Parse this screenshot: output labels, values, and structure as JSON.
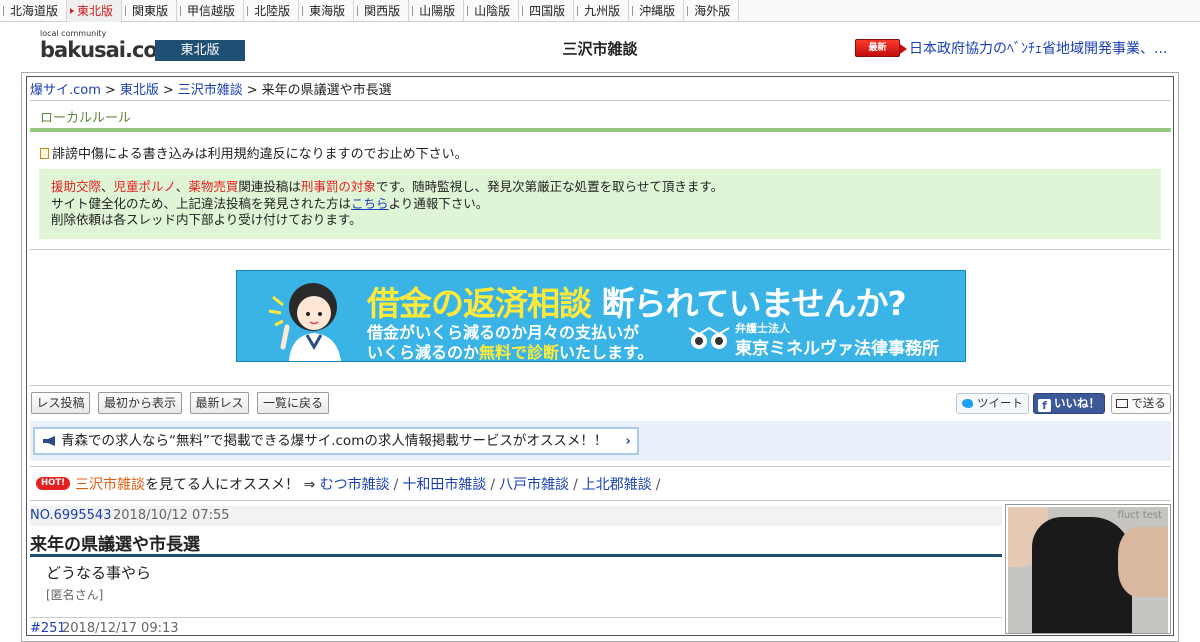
{
  "regions": [
    {
      "label": "北海道版",
      "active": false
    },
    {
      "label": "東北版",
      "active": true
    },
    {
      "label": "関東版",
      "active": false
    },
    {
      "label": "甲信越版",
      "active": false
    },
    {
      "label": "北陸版",
      "active": false
    },
    {
      "label": "東海版",
      "active": false
    },
    {
      "label": "関西版",
      "active": false
    },
    {
      "label": "山陽版",
      "active": false
    },
    {
      "label": "山陰版",
      "active": false
    },
    {
      "label": "四国版",
      "active": false
    },
    {
      "label": "九州版",
      "active": false
    },
    {
      "label": "沖縄版",
      "active": false
    },
    {
      "label": "海外版",
      "active": false
    }
  ],
  "header": {
    "logo_small": "local community",
    "logo": "bakusai.com",
    "region_badge": "東北版",
    "board_title": "三沢市雑談",
    "news_badge": "最新NEWS",
    "news_text": "日本政府協力のﾍﾞﾝﾁｪ省地域開発事業、..."
  },
  "breadcrumb": {
    "items": [
      "爆サイ.com",
      "東北版",
      "三沢市雑談"
    ],
    "current": "来年の県議選や市長選",
    "separator": ">"
  },
  "rules": {
    "title": "ローカルルール",
    "notice": "誹謗中傷による書き込みは利用規約違反になりますのでお止め下さい。",
    "warn_red1": "援助交際",
    "warn_red2": "児童ポルノ",
    "warn_red3": "薬物売買",
    "warn_mid": "関連投稿は",
    "warn_red4": "刑事罰の対象",
    "warn_end": "です。随時監視し、発見次第厳正な処置を取らせて頂きます。",
    "line2_pre": "サイト健全化のため、上記違法投稿を発見された方は",
    "line2_link": "こちら",
    "line2_post": "より通報下さい。",
    "line3": "削除依頼は各スレッド内下部より受け付けております。",
    "comma": "、"
  },
  "banner": {
    "headline_a": "借金の返済相談",
    "headline_b": "断られていませんか?",
    "sub1": "借金がいくら減るのか月々の支払いが",
    "sub2_a": "いくら減るのか",
    "sub2_b": "無料で診断",
    "sub2_c": "いたします。",
    "firm_small": "弁護士法人",
    "firm": "東京ミネルヴァ法律事務所"
  },
  "toolbar": {
    "post_reply": "レス投稿",
    "from_start": "最初から表示",
    "latest": "最新レス",
    "back_to_list": "一覧に戻る",
    "tweet": "ツイート",
    "like": "いいね！",
    "send": "で送る"
  },
  "promo": {
    "text": "青森での求人なら“無料”で掲載できる爆サイ.comの求人情報掲載サービスがオススメ！！",
    "arrow": "›"
  },
  "related": {
    "badge": "HOT!",
    "current": "三沢市雑談",
    "lead": "を見てる人にオススメ！ ⇒",
    "links": [
      "むつ市雑談",
      "十和田市雑談",
      "八戸市雑談",
      "上北郡雑談"
    ],
    "separator": "/"
  },
  "post": {
    "number": "NO.6995543",
    "date": "2018/10/12 07:55",
    "title": "来年の県議選や市長選",
    "body": "どうなる事やら",
    "author": "[匿名さん]"
  },
  "reply": {
    "number": "#251",
    "date": "2018/12/17 09:13"
  },
  "side_ad": {
    "label": "fluct test"
  },
  "colors": {
    "accent_navy": "#1f4f73",
    "warning_red": "#e52020",
    "rules_green": "#94c97f",
    "link_blue": "#1a3fb3"
  }
}
